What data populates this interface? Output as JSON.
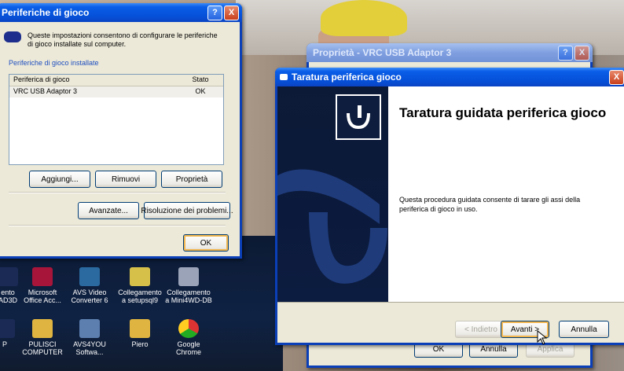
{
  "periph_window": {
    "title": "Periferiche di gioco",
    "description": "Queste impostazioni consentono di configurare le periferiche di gioco installate sul computer.",
    "group_label": "Periferiche di gioco installate",
    "columns": [
      "Periferica di gioco",
      "Stato"
    ],
    "rows": [
      {
        "name": "VRC USB Adaptor 3",
        "status": "OK"
      }
    ],
    "buttons": {
      "add": "Aggiungi...",
      "remove": "Rimuovi",
      "properties": "Proprietà",
      "advanced": "Avanzate...",
      "troubleshoot": "Risoluzione dei problemi...",
      "ok": "OK"
    }
  },
  "prop_window": {
    "title": "Proprietà - VRC USB Adaptor 3",
    "buttons": {
      "ok": "OK",
      "cancel": "Annulla",
      "apply": "Applica"
    }
  },
  "wizard_window": {
    "title": "Taratura periferica gioco",
    "heading": "Taratura guidata periferica gioco",
    "text": "Questa procedura guidata consente di tarare gli assi della periferica di gioco in uso.",
    "buttons": {
      "back": "< Indietro",
      "next": "Avanti >",
      "cancel": "Annulla"
    }
  },
  "titlebar_buttons": {
    "help": "?",
    "close": "X"
  },
  "desktop_icons": [
    {
      "label": "ento\nAD3D"
    },
    {
      "label": "Microsoft\nOffice Acc..."
    },
    {
      "label": "AVS Video\nConverter 6"
    },
    {
      "label": "Collegamento\na setupsql9"
    },
    {
      "label": "Collegamento\na Mini4WD-DB"
    },
    {
      "label": "P"
    },
    {
      "label": "PULISCI\nCOMPUTER"
    },
    {
      "label": "AVS4YOU\nSoftwa..."
    },
    {
      "label": "Piero"
    },
    {
      "label": "Google\nChrome"
    }
  ]
}
